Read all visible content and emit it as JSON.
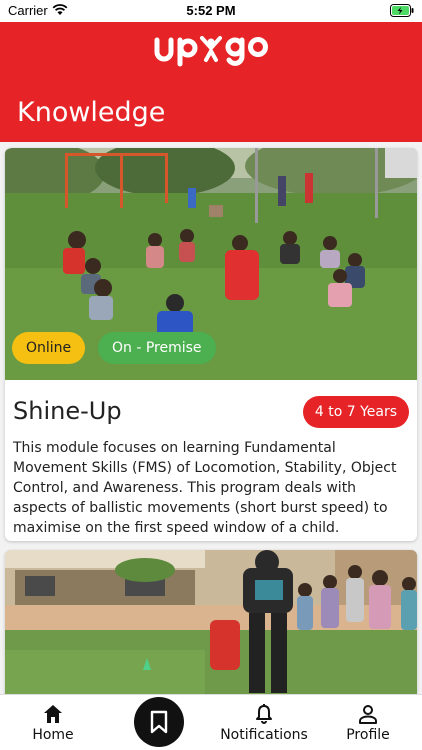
{
  "status_bar": {
    "carrier": "Carrier",
    "time": "5:52 PM"
  },
  "header": {
    "logo_text": "upgo",
    "title": "Knowledge"
  },
  "cards": [
    {
      "image_icon": "photo-children-playing-outdoors",
      "badges": [
        "Online",
        "On - Premise"
      ],
      "title": "Shine-Up",
      "age": "4 to 7 Years",
      "description": "This module focuses on learning Fundamental Movement Skills (FMS) of Locomotion, Stability, Object Control, and Awareness. This program deals with aspects of ballistic movements (short burst speed) to maximise on the first speed window of a child."
    },
    {
      "image_icon": "photo-children-group-activity"
    }
  ],
  "bottom_nav": {
    "home": "Home",
    "notifications": "Notifications",
    "profile": "Profile"
  },
  "colors": {
    "brand_red": "#e62427",
    "online_yellow": "#f5c012",
    "premise_green": "#4caf50"
  }
}
